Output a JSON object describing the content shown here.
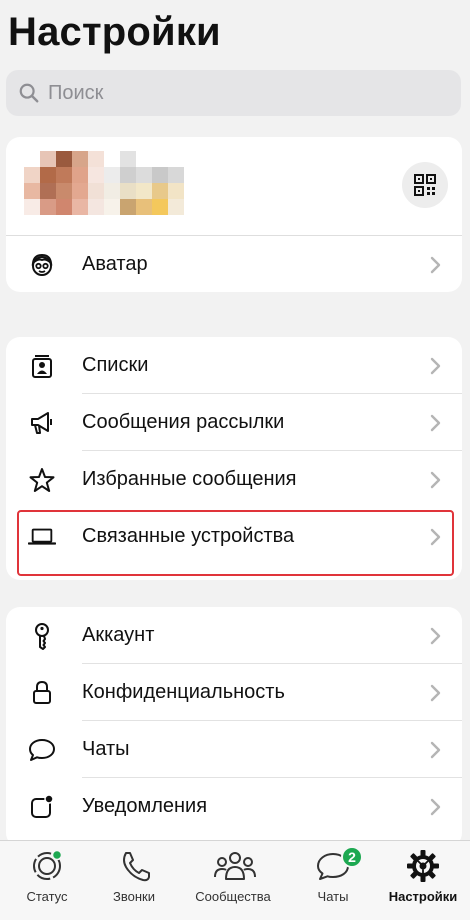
{
  "page": {
    "title": "Настройки"
  },
  "search": {
    "placeholder": "Поиск"
  },
  "profile": {
    "qr_icon": "qr-code-icon",
    "avatar_colors": [
      "#ffffff",
      "#e7c5b6",
      "#9a5a3e",
      "#d7a58a",
      "#f4e1d8",
      "#ffffff",
      "#e2e2e2",
      "#ffffff",
      "#ffffff",
      "#ffffff",
      "#ffffff",
      "#f0d4c6",
      "#b26a48",
      "#c07a5a",
      "#e0a38a",
      "#f6e6e0",
      "#ececec",
      "#cfcfcf",
      "#dcdcdc",
      "#c9c9c9",
      "#d8d8d8",
      "#ffffff",
      "#e8b8a2",
      "#b06f55",
      "#c98a6c",
      "#e3a890",
      "#f1e0d6",
      "#f1ede4",
      "#e9dfc6",
      "#f2e7c8",
      "#e8c98a",
      "#f2e4c6",
      "#ffffff",
      "#f8ebe6",
      "#d99b86",
      "#d0866e",
      "#e9b6a4",
      "#f4e6e0",
      "#f7f2ea",
      "#c9a470",
      "#e8c07a",
      "#f4c85c",
      "#f3ead9",
      "#ffffff"
    ]
  },
  "avatar_row": {
    "label": "Аватар",
    "icon": "avatar-face-icon"
  },
  "tools": [
    {
      "label": "Списки",
      "icon": "lists-icon"
    },
    {
      "label": "Сообщения рассылки",
      "icon": "megaphone-icon"
    },
    {
      "label": "Избранные сообщения",
      "icon": "star-icon"
    },
    {
      "label": "Связанные устройства",
      "icon": "laptop-icon"
    }
  ],
  "account_section": [
    {
      "label": "Аккаунт",
      "icon": "key-icon"
    },
    {
      "label": "Конфиденциальность",
      "icon": "lock-icon"
    },
    {
      "label": "Чаты",
      "icon": "chat-bubble-icon"
    },
    {
      "label": "Уведомления",
      "icon": "notification-icon"
    }
  ],
  "tabbar": {
    "tabs": [
      {
        "label": "Статус",
        "icon": "status-icon"
      },
      {
        "label": "Звонки",
        "icon": "phone-icon"
      },
      {
        "label": "Сообщества",
        "icon": "communities-icon"
      },
      {
        "label": "Чаты",
        "icon": "chats-icon",
        "badge": "2"
      },
      {
        "label": "Настройки",
        "icon": "settings-icon",
        "active": true
      }
    ]
  },
  "colors": {
    "accent": "#1da851",
    "highlight": "#e0343a"
  }
}
